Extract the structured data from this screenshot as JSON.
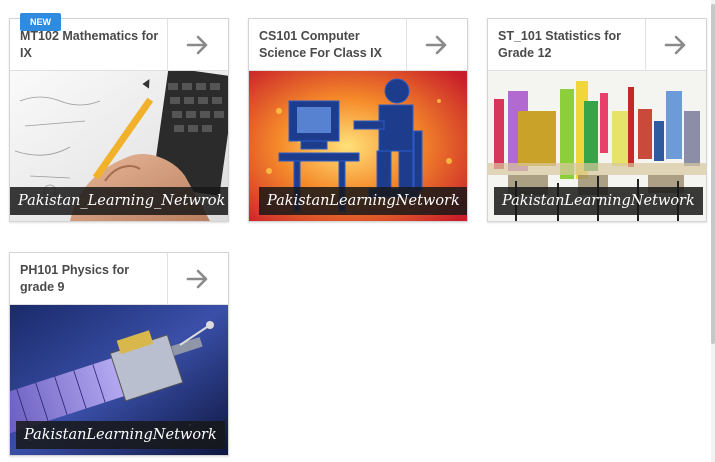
{
  "new_badge": "NEW",
  "cards": [
    {
      "title": "MT102 Mathematics for IX",
      "caption": "Pakistan_Learning_Netwrok",
      "arrow_icon": "arrow-right-icon"
    },
    {
      "title": "CS101 Computer Science For Class IX",
      "caption": "PakistanLearningNetwork",
      "arrow_icon": "arrow-right-icon"
    },
    {
      "title": "ST_101 Statistics for Grade 12",
      "caption": "PakistanLearningNetwork",
      "arrow_icon": "arrow-right-icon"
    },
    {
      "title": "PH101 Physics for grade 9",
      "caption": "PakistanLearningNetwork",
      "arrow_icon": "arrow-right-icon"
    }
  ],
  "colors": {
    "badge": "#2f8be0",
    "arrow": "#8a8a8a",
    "title": "#4a4a4a"
  }
}
